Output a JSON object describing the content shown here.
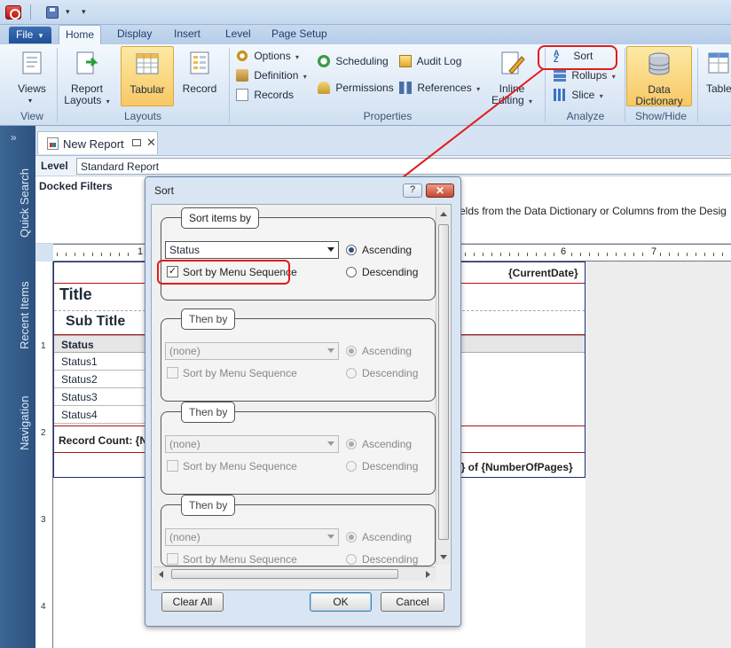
{
  "ribbon": {
    "file_tab": "File",
    "tabs": [
      "Home",
      "Display",
      "Insert",
      "Level",
      "Page Setup"
    ],
    "groups": {
      "view": {
        "label": "View",
        "views": "Views"
      },
      "layouts": {
        "label": "Layouts",
        "report_layouts_1": "Report",
        "report_layouts_2": "Layouts",
        "tabular": "Tabular",
        "record": "Record"
      },
      "properties": {
        "label": "Properties",
        "options": "Options",
        "definition": "Definition",
        "records": "Records",
        "scheduling": "Scheduling",
        "permissions": "Permissions",
        "audit_log": "Audit Log",
        "references": "References",
        "inline_editing_1": "Inline",
        "inline_editing_2": "Editing"
      },
      "analyze": {
        "label": "Analyze",
        "sort": "Sort",
        "rollups": "Rollups",
        "slice": "Slice"
      },
      "show_hide": {
        "label": "Show/Hide",
        "data_dictionary_1": "Data",
        "data_dictionary_2": "Dictionary"
      },
      "table": "Table"
    }
  },
  "sidebar": {
    "items": [
      "Quick Search",
      "Recent Items",
      "Navigation"
    ]
  },
  "document": {
    "tab_title": "New Report",
    "level_label": "Level",
    "level_value": "Standard Report",
    "docked_filters": "Docked Filters",
    "docked_hint": "elds from the Data Dictionary or Columns from the Desig",
    "ruler": [
      "1",
      "6",
      "7"
    ],
    "vruler": [
      "1",
      "2",
      "3",
      "4"
    ],
    "design": {
      "current_date": "{CurrentDate}",
      "title": "Title",
      "subtitle": "Sub Title",
      "status_header": "Status",
      "status_rows": [
        "Status1",
        "Status2",
        "Status3",
        "Status4"
      ],
      "record_count": "Record Count: {N",
      "page_footer": "r} of {NumberOfPages}"
    }
  },
  "dialog": {
    "title": "Sort",
    "help": "?",
    "close": "✕",
    "groups": [
      {
        "legend": "Sort items by",
        "field": "Status",
        "sort_by_menu": "Sort by Menu Sequence",
        "sort_by_menu_checked": true,
        "ascending": "Ascending",
        "descending": "Descending",
        "direction": "Ascending",
        "enabled": true
      },
      {
        "legend": "Then by",
        "field": "(none)",
        "sort_by_menu": "Sort by Menu Sequence",
        "sort_by_menu_checked": false,
        "ascending": "Ascending",
        "descending": "Descending",
        "direction": "Ascending",
        "enabled": false
      },
      {
        "legend": "Then by",
        "field": "(none)",
        "sort_by_menu": "Sort by Menu Sequence",
        "sort_by_menu_checked": false,
        "ascending": "Ascending",
        "descending": "Descending",
        "direction": "Ascending",
        "enabled": false
      },
      {
        "legend": "Then by",
        "field": "(none)",
        "sort_by_menu": "Sort by Menu Sequence",
        "sort_by_menu_checked": false,
        "ascending": "Ascending",
        "descending": "Descending",
        "direction": "Ascending",
        "enabled": false
      }
    ],
    "clear_all": "Clear All",
    "ok": "OK",
    "cancel": "Cancel"
  },
  "colors": {
    "callout": "#e11b1b",
    "ribbon_highlight": "#f8c865",
    "sidebar": "#2c527f"
  },
  "icons": {
    "app": "app-logo-icon",
    "save": "save-icon",
    "views": "views-icon",
    "report_layouts": "report-layouts-icon",
    "tabular": "tabular-icon",
    "record": "record-icon",
    "sort": "sort-az-icon",
    "data_dictionary": "database-icon"
  }
}
